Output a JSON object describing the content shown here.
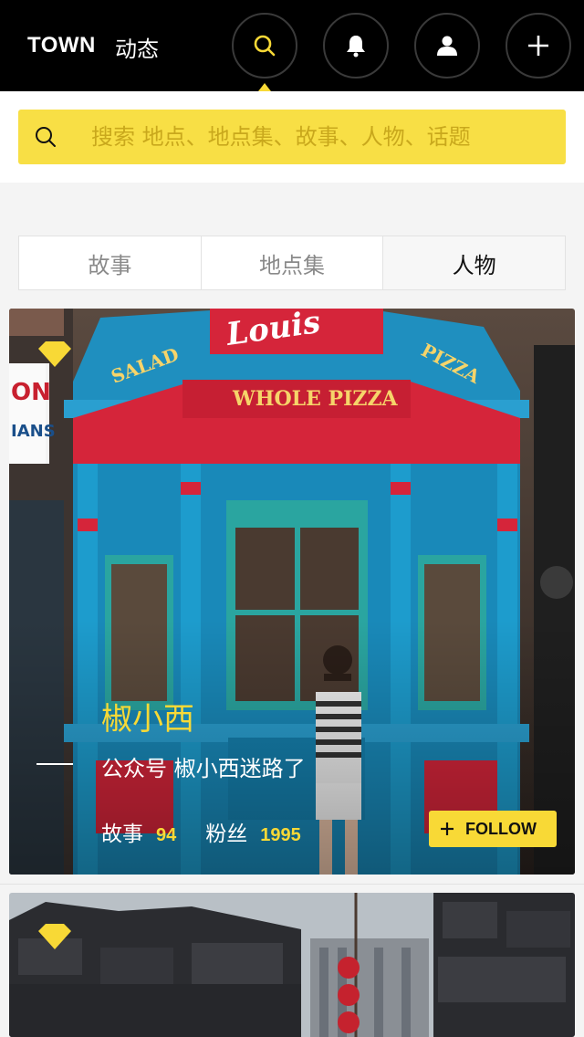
{
  "header": {
    "brand": "TOWN",
    "dynamic_tab": "动态",
    "icons": [
      "search-icon",
      "bell-icon",
      "user-icon",
      "add-icon"
    ],
    "accent_color": "#f8d936"
  },
  "search": {
    "placeholder": "搜索 地点、地点集、故事、人物、话题"
  },
  "tabs": [
    {
      "label": "故事",
      "active": false
    },
    {
      "label": "地点集",
      "active": false
    },
    {
      "label": "人物",
      "active": true
    }
  ],
  "cards": [
    {
      "name": "椒小西",
      "bio": "公众号 椒小西迷路了",
      "stories_label": "故事",
      "stories_count": "94",
      "fans_label": "粉丝",
      "fans_count": "1995",
      "follow_label": "FOLLOW",
      "storefront_signs": [
        "SALAD",
        "PIZZA",
        "WHOLE PIZZA",
        "Louis",
        "ON",
        "IANS"
      ]
    }
  ]
}
